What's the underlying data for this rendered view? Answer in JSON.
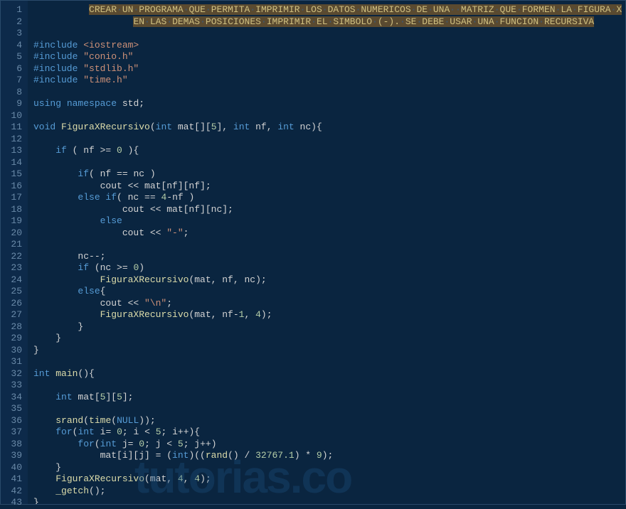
{
  "watermark": "tutorias.co",
  "lines": [
    {
      "num": "1",
      "tokens": [
        {
          "t": "hl",
          "c": "comment-line",
          "v": "CREAR·UN·PROGRAMA·QUE·PERMITA·IMPRIMIR·LOS·DATOS·NUMERICOS·DE·UNA··MATRIZ·QUE·FORMEN·LA·FIGURA·X"
        }
      ],
      "indent": 10
    },
    {
      "num": "2",
      "tokens": [
        {
          "t": "hl",
          "c": "comment-line",
          "v": "EN·LAS·DEMAS·POSICIONES·IMPRIMIR·EL·SIMBOLO·(-).·SE·DEBE·USAR·UNA·FUNCION·RECURSIVA"
        }
      ],
      "indent": 18
    },
    {
      "num": "3",
      "tokens": []
    },
    {
      "num": "4",
      "tokens": [
        {
          "c": "kw",
          "v": "#include "
        },
        {
          "c": "str",
          "v": "<iostream>"
        }
      ]
    },
    {
      "num": "5",
      "tokens": [
        {
          "c": "kw",
          "v": "#include "
        },
        {
          "c": "str",
          "v": "\"conio.h\""
        }
      ]
    },
    {
      "num": "6",
      "tokens": [
        {
          "c": "kw",
          "v": "#include "
        },
        {
          "c": "str",
          "v": "\"stdlib.h\""
        }
      ]
    },
    {
      "num": "7",
      "tokens": [
        {
          "c": "kw",
          "v": "#include "
        },
        {
          "c": "str",
          "v": "\"time.h\""
        }
      ]
    },
    {
      "num": "8",
      "tokens": []
    },
    {
      "num": "9",
      "tokens": [
        {
          "c": "kw",
          "v": "using"
        },
        {
          "c": "id",
          "v": " "
        },
        {
          "c": "kw",
          "v": "namespace"
        },
        {
          "c": "id",
          "v": " std;"
        }
      ]
    },
    {
      "num": "10",
      "tokens": []
    },
    {
      "num": "11",
      "tokens": [
        {
          "c": "kw",
          "v": "void"
        },
        {
          "c": "id",
          "v": " "
        },
        {
          "c": "fn",
          "v": "FiguraXRecursivo"
        },
        {
          "c": "id",
          "v": "("
        },
        {
          "c": "kw",
          "v": "int"
        },
        {
          "c": "id",
          "v": " mat[]["
        },
        {
          "c": "num",
          "v": "5"
        },
        {
          "c": "id",
          "v": "], "
        },
        {
          "c": "kw",
          "v": "int"
        },
        {
          "c": "id",
          "v": " nf, "
        },
        {
          "c": "kw",
          "v": "int"
        },
        {
          "c": "id",
          "v": " nc){"
        }
      ]
    },
    {
      "num": "12",
      "tokens": []
    },
    {
      "num": "13",
      "tokens": [
        {
          "c": "id",
          "v": "    "
        },
        {
          "c": "kw",
          "v": "if"
        },
        {
          "c": "id",
          "v": " ( nf >= "
        },
        {
          "c": "num",
          "v": "0"
        },
        {
          "c": "id",
          "v": " ){"
        }
      ]
    },
    {
      "num": "14",
      "tokens": []
    },
    {
      "num": "15",
      "tokens": [
        {
          "c": "id",
          "v": "        "
        },
        {
          "c": "kw",
          "v": "if"
        },
        {
          "c": "id",
          "v": "( nf == nc )"
        }
      ]
    },
    {
      "num": "16",
      "tokens": [
        {
          "c": "id",
          "v": "            cout << mat[nf][nf];"
        }
      ]
    },
    {
      "num": "17",
      "tokens": [
        {
          "c": "id",
          "v": "        "
        },
        {
          "c": "kw",
          "v": "else if"
        },
        {
          "c": "id",
          "v": "( nc == "
        },
        {
          "c": "num",
          "v": "4"
        },
        {
          "c": "id",
          "v": "-nf )"
        }
      ]
    },
    {
      "num": "18",
      "tokens": [
        {
          "c": "id",
          "v": "                cout << mat[nf][nc];"
        }
      ]
    },
    {
      "num": "19",
      "tokens": [
        {
          "c": "id",
          "v": "            "
        },
        {
          "c": "kw",
          "v": "else"
        }
      ]
    },
    {
      "num": "20",
      "tokens": [
        {
          "c": "id",
          "v": "                cout << "
        },
        {
          "c": "str",
          "v": "\"-\""
        },
        {
          "c": "id",
          "v": ";"
        }
      ]
    },
    {
      "num": "21",
      "tokens": []
    },
    {
      "num": "22",
      "tokens": [
        {
          "c": "id",
          "v": "        nc--;"
        }
      ]
    },
    {
      "num": "23",
      "tokens": [
        {
          "c": "id",
          "v": "        "
        },
        {
          "c": "kw",
          "v": "if"
        },
        {
          "c": "id",
          "v": " (nc >= "
        },
        {
          "c": "num",
          "v": "0"
        },
        {
          "c": "id",
          "v": ")"
        }
      ]
    },
    {
      "num": "24",
      "tokens": [
        {
          "c": "id",
          "v": "            "
        },
        {
          "c": "fn",
          "v": "FiguraXRecursivo"
        },
        {
          "c": "id",
          "v": "(mat, nf, nc);"
        }
      ]
    },
    {
      "num": "25",
      "tokens": [
        {
          "c": "id",
          "v": "        "
        },
        {
          "c": "kw",
          "v": "else"
        },
        {
          "c": "id",
          "v": "{"
        }
      ]
    },
    {
      "num": "26",
      "tokens": [
        {
          "c": "id",
          "v": "            cout << "
        },
        {
          "c": "str",
          "v": "\"\\n\""
        },
        {
          "c": "id",
          "v": ";"
        }
      ]
    },
    {
      "num": "27",
      "tokens": [
        {
          "c": "id",
          "v": "            "
        },
        {
          "c": "fn",
          "v": "FiguraXRecursivo"
        },
        {
          "c": "id",
          "v": "(mat, nf-"
        },
        {
          "c": "num",
          "v": "1"
        },
        {
          "c": "id",
          "v": ", "
        },
        {
          "c": "num",
          "v": "4"
        },
        {
          "c": "id",
          "v": ");"
        }
      ]
    },
    {
      "num": "28",
      "tokens": [
        {
          "c": "id",
          "v": "        }"
        }
      ]
    },
    {
      "num": "29",
      "tokens": [
        {
          "c": "id",
          "v": "    }"
        }
      ]
    },
    {
      "num": "30",
      "tokens": [
        {
          "c": "id",
          "v": "}"
        }
      ]
    },
    {
      "num": "31",
      "tokens": []
    },
    {
      "num": "32",
      "tokens": [
        {
          "c": "kw",
          "v": "int"
        },
        {
          "c": "id",
          "v": " "
        },
        {
          "c": "fn",
          "v": "main"
        },
        {
          "c": "id",
          "v": "(){"
        }
      ]
    },
    {
      "num": "33",
      "tokens": []
    },
    {
      "num": "34",
      "tokens": [
        {
          "c": "id",
          "v": "    "
        },
        {
          "c": "kw",
          "v": "int"
        },
        {
          "c": "id",
          "v": " mat["
        },
        {
          "c": "num",
          "v": "5"
        },
        {
          "c": "id",
          "v": "]["
        },
        {
          "c": "num",
          "v": "5"
        },
        {
          "c": "id",
          "v": "];"
        }
      ]
    },
    {
      "num": "35",
      "tokens": []
    },
    {
      "num": "36",
      "tokens": [
        {
          "c": "id",
          "v": "    "
        },
        {
          "c": "fn",
          "v": "srand"
        },
        {
          "c": "id",
          "v": "("
        },
        {
          "c": "fn",
          "v": "time"
        },
        {
          "c": "id",
          "v": "("
        },
        {
          "c": "const",
          "v": "NULL"
        },
        {
          "c": "id",
          "v": "));"
        }
      ]
    },
    {
      "num": "37",
      "tokens": [
        {
          "c": "id",
          "v": "    "
        },
        {
          "c": "kw",
          "v": "for"
        },
        {
          "c": "id",
          "v": "("
        },
        {
          "c": "kw",
          "v": "int"
        },
        {
          "c": "id",
          "v": " i= "
        },
        {
          "c": "num",
          "v": "0"
        },
        {
          "c": "id",
          "v": "; i < "
        },
        {
          "c": "num",
          "v": "5"
        },
        {
          "c": "id",
          "v": "; i++){"
        }
      ]
    },
    {
      "num": "38",
      "tokens": [
        {
          "c": "id",
          "v": "        "
        },
        {
          "c": "kw",
          "v": "for"
        },
        {
          "c": "id",
          "v": "("
        },
        {
          "c": "kw",
          "v": "int"
        },
        {
          "c": "id",
          "v": " j= "
        },
        {
          "c": "num",
          "v": "0"
        },
        {
          "c": "id",
          "v": "; j < "
        },
        {
          "c": "num",
          "v": "5"
        },
        {
          "c": "id",
          "v": "; j++)"
        }
      ]
    },
    {
      "num": "39",
      "tokens": [
        {
          "c": "id",
          "v": "            mat[i][j] = ("
        },
        {
          "c": "kw",
          "v": "int"
        },
        {
          "c": "id",
          "v": ")(("
        },
        {
          "c": "fn",
          "v": "rand"
        },
        {
          "c": "id",
          "v": "() / "
        },
        {
          "c": "num",
          "v": "32767.1"
        },
        {
          "c": "id",
          "v": ") * "
        },
        {
          "c": "num",
          "v": "9"
        },
        {
          "c": "id",
          "v": ");"
        }
      ]
    },
    {
      "num": "40",
      "tokens": [
        {
          "c": "id",
          "v": "    }"
        }
      ]
    },
    {
      "num": "41",
      "tokens": [
        {
          "c": "id",
          "v": "    "
        },
        {
          "c": "fn",
          "v": "FiguraXRecursivo"
        },
        {
          "c": "id",
          "v": "(mat, "
        },
        {
          "c": "num",
          "v": "4"
        },
        {
          "c": "id",
          "v": ", "
        },
        {
          "c": "num",
          "v": "4"
        },
        {
          "c": "id",
          "v": ");"
        }
      ]
    },
    {
      "num": "42",
      "tokens": [
        {
          "c": "id",
          "v": "    "
        },
        {
          "c": "fn",
          "v": "_getch"
        },
        {
          "c": "id",
          "v": "();"
        }
      ]
    },
    {
      "num": "43",
      "tokens": [
        {
          "c": "id",
          "v": "}"
        }
      ]
    }
  ]
}
